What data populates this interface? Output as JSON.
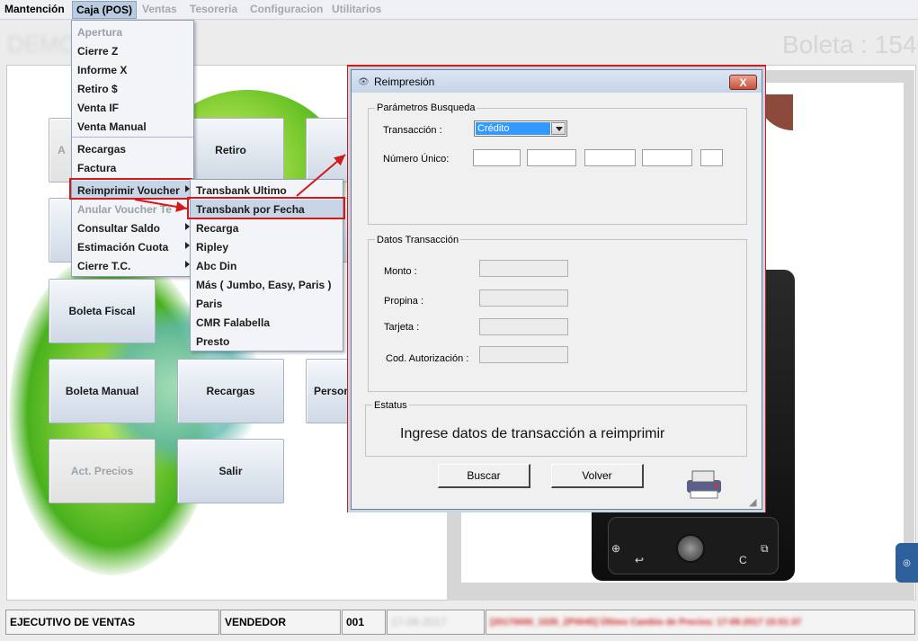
{
  "menubar": {
    "items": [
      {
        "label": "Mantención",
        "state": "normal"
      },
      {
        "label": "Caja (POS)",
        "state": "active"
      },
      {
        "label": "Ventas",
        "state": "disabled"
      },
      {
        "label": "Tesoreria",
        "state": "disabled"
      },
      {
        "label": "Configuracion",
        "state": "disabled"
      },
      {
        "label": "Utilitarios",
        "state": "disabled"
      }
    ]
  },
  "header": {
    "left_title": "DEMO ... 07",
    "right_title": "Boleta : 154"
  },
  "pos_buttons": [
    {
      "label": "Retiro",
      "enabled": true
    },
    {
      "label": "Boleta Fiscal",
      "enabled": true
    },
    {
      "label": "Boleta Manual",
      "enabled": true
    },
    {
      "label": "Recargas",
      "enabled": true
    },
    {
      "label": "Person",
      "enabled": true
    },
    {
      "label": "Act. Precios",
      "enabled": false
    },
    {
      "label": "Salir",
      "enabled": true
    },
    {
      "label": "Fa",
      "enabled": true
    },
    {
      "label": "A",
      "enabled": false
    }
  ],
  "caja_menu": {
    "items": [
      {
        "label": "Apertura",
        "enabled": false,
        "submenu": false
      },
      {
        "label": "Cierre Z",
        "enabled": true,
        "submenu": false
      },
      {
        "label": "Informe X",
        "enabled": true,
        "submenu": false
      },
      {
        "label": "Retiro $",
        "enabled": true,
        "submenu": false
      },
      {
        "label": "Venta IF",
        "enabled": true,
        "submenu": false
      },
      {
        "label": "Venta Manual",
        "enabled": true,
        "submenu": false
      },
      {
        "label": "Recargas",
        "enabled": true,
        "submenu": false
      },
      {
        "label": "Factura",
        "enabled": true,
        "submenu": false
      },
      {
        "label": "Reimprimir Voucher",
        "enabled": true,
        "submenu": true,
        "highlighted": true
      },
      {
        "label": "Anular Voucher Te",
        "enabled": false,
        "submenu": false
      },
      {
        "label": "Consultar Saldo",
        "enabled": true,
        "submenu": true
      },
      {
        "label": "Estimación Cuota",
        "enabled": true,
        "submenu": true
      },
      {
        "label": "Cierre T.C.",
        "enabled": true,
        "submenu": true
      }
    ]
  },
  "reimprimir_submenu": {
    "items": [
      {
        "label": "Transbank Ultimo"
      },
      {
        "label": "Transbank por Fecha",
        "highlighted": true
      },
      {
        "label": "Recarga"
      },
      {
        "label": "Ripley"
      },
      {
        "label": "Abc Din"
      },
      {
        "label": "Más ( Jumbo, Easy, Paris )"
      },
      {
        "label": "Paris"
      },
      {
        "label": "CMR Falabella"
      },
      {
        "label": "Presto"
      }
    ]
  },
  "dialog": {
    "title": "Reimpresión",
    "close_label": "X",
    "params_group": {
      "legend": "Parámetros Busqueda",
      "transaccion_label": "Transacción :",
      "transaccion_value": "Crédito",
      "numero_label": "Número Único:"
    },
    "datos_group": {
      "legend": "Datos Transacción",
      "monto_label": "Monto :",
      "propina_label": "Propina :",
      "tarjeta_label": "Tarjeta :",
      "cod_label": "Cod. Autorización :"
    },
    "status_group": {
      "legend": "Estatus",
      "message": "Ingrese datos de transacción a reimprimir"
    },
    "buscar_label": "Buscar",
    "volver_label": "Volver"
  },
  "statusbar": {
    "role": "EJECUTIVO DE VENTAS",
    "user": "VENDEDOR",
    "code": "001",
    "date_blurred": "17-08-2017",
    "message_blurred": "[20170000_1535_ZP0045] Último Cambio de Precios: 17-08-2017 15:51:37"
  },
  "phone": {
    "left_key": "⊕",
    "back_key": "↩",
    "c_key": "C",
    "right_key": "⧉"
  },
  "colors": {
    "highlight_red": "#d11a1a",
    "menu_bg": "#f2f4f7",
    "selection_blue": "#3399ff"
  }
}
